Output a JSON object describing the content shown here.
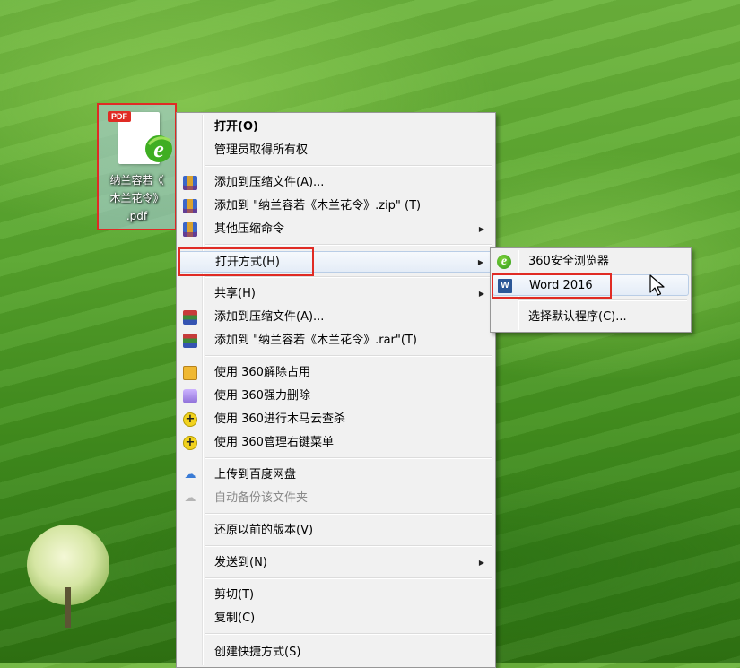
{
  "desktop_icon": {
    "badge": "PDF",
    "name_lines": [
      "纳兰容若《",
      "木兰花令》",
      ".pdf"
    ]
  },
  "main_menu": {
    "items": [
      {
        "label": "打开(O)",
        "icon": "none",
        "bold": true
      },
      {
        "label": "管理员取得所有权",
        "icon": "none"
      },
      {
        "label": "添加到压缩文件(A)...",
        "icon": "winrar-icon"
      },
      {
        "label": "添加到 \"纳兰容若《木兰花令》.zip\" (T)",
        "icon": "winrar-icon"
      },
      {
        "label": "其他压缩命令",
        "icon": "winrar-icon",
        "submenu": true
      },
      {
        "label": "打开方式(H)",
        "icon": "none",
        "submenu": true,
        "highlighted": true
      },
      {
        "label": "共享(H)",
        "icon": "none",
        "submenu": true
      },
      {
        "label": "添加到压缩文件(A)...",
        "icon": "rar-icon"
      },
      {
        "label": "添加到 \"纳兰容若《木兰花令》.rar\"(T)",
        "icon": "rar-icon"
      },
      {
        "label": "使用 360解除占用",
        "icon": "unlock-360-icon"
      },
      {
        "label": "使用 360强力删除",
        "icon": "shred-360-icon"
      },
      {
        "label": "使用 360进行木马云查杀",
        "icon": "scan-360-icon"
      },
      {
        "label": "使用 360管理右键菜单",
        "icon": "menu-360-icon"
      },
      {
        "label": "上传到百度网盘",
        "icon": "baidu-cloud-icon"
      },
      {
        "label": "自动备份该文件夹",
        "icon": "baidu-cloud-icon",
        "disabled": true
      },
      {
        "label": "还原以前的版本(V)",
        "icon": "none"
      },
      {
        "label": "发送到(N)",
        "icon": "none",
        "submenu": true
      },
      {
        "label": "剪切(T)",
        "icon": "none"
      },
      {
        "label": "复制(C)",
        "icon": "none"
      },
      {
        "label": "创建快捷方式(S)",
        "icon": "none"
      }
    ]
  },
  "open_with_menu": {
    "items": [
      {
        "label": "360安全浏览器",
        "icon": "360-browser-icon"
      },
      {
        "label": "Word 2016",
        "icon": "word-icon",
        "highlighted": true
      },
      {
        "label": "选择默认程序(C)...",
        "icon": "none"
      }
    ]
  },
  "colors": {
    "highlight_box": "#e02b24",
    "menu_bg": "#f1f1f1"
  }
}
